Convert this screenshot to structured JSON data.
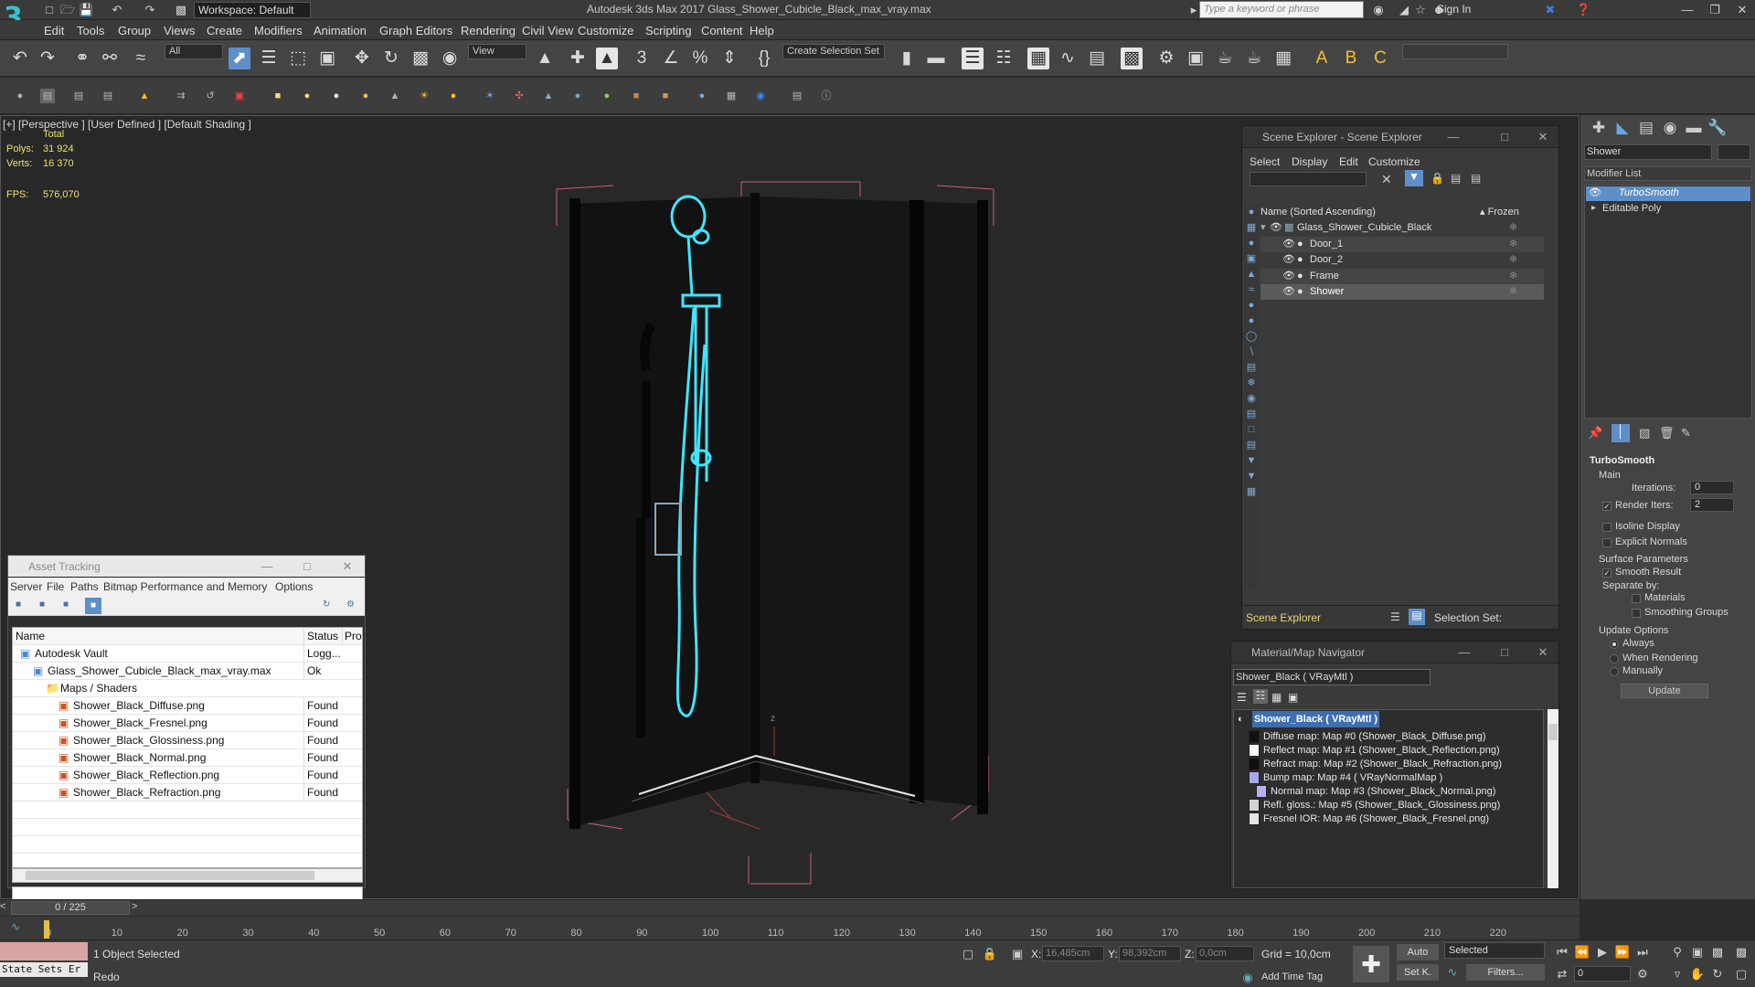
{
  "titlebar": {
    "workspace": "Workspace: Default",
    "window_title": "Autodesk 3ds Max 2017     Glass_Shower_Cubicle_Black_max_vray.max",
    "search_placeholder": "Type a keyword or phrase",
    "sign_in": "Sign In"
  },
  "menu": [
    "Edit",
    "Tools",
    "Group",
    "Views",
    "Create",
    "Modifiers",
    "Animation",
    "Graph Editors",
    "Rendering",
    "Civil View",
    "Customize",
    "Scripting",
    "Content",
    "Help"
  ],
  "toolbar": {
    "filter": "All",
    "ref_coord": "View",
    "selection_set": "Create Selection Set"
  },
  "viewport": {
    "label": "[+] [Perspective ]  [User Defined ]  [Default Shading ]",
    "stats_header": "Total",
    "polys_label": "Polys:",
    "polys_value": "31 924",
    "verts_label": "Verts:",
    "verts_value": "16 370",
    "fps_label": "FPS:",
    "fps_value": "576,070"
  },
  "scene_explorer": {
    "title": "Scene Explorer - Scene Explorer",
    "menu": [
      "Select",
      "Display",
      "Edit",
      "Customize"
    ],
    "col_name": "Name (Sorted Ascending)",
    "col_frozen": "▴ Frozen",
    "root": "Glass_Shower_Cubicle_Black",
    "children": [
      "Door_1",
      "Door_2",
      "Frame",
      "Shower"
    ],
    "footer_label": "Scene Explorer",
    "selection_set": "Selection Set:"
  },
  "asset_tracking": {
    "title": "Asset Tracking",
    "menu": [
      "Server",
      "File",
      "Paths",
      "Bitmap Performance and Memory",
      "Options"
    ],
    "headers": [
      "Name",
      "Status",
      "Prox"
    ],
    "rows": [
      {
        "name": "Autodesk Vault",
        "status": "Logg...",
        "indent": 0
      },
      {
        "name": "Glass_Shower_Cubicle_Black_max_vray.max",
        "status": "Ok",
        "indent": 1
      },
      {
        "name": "Maps / Shaders",
        "status": "",
        "indent": 2
      },
      {
        "name": "Shower_Black_Diffuse.png",
        "status": "Found",
        "indent": 3
      },
      {
        "name": "Shower_Black_Fresnel.png",
        "status": "Found",
        "indent": 3
      },
      {
        "name": "Shower_Black_Glossiness.png",
        "status": "Found",
        "indent": 3
      },
      {
        "name": "Shower_Black_Normal.png",
        "status": "Found",
        "indent": 3
      },
      {
        "name": "Shower_Black_Reflection.png",
        "status": "Found",
        "indent": 3
      },
      {
        "name": "Shower_Black_Refraction.png",
        "status": "Found",
        "indent": 3
      }
    ]
  },
  "material_navigator": {
    "title": "Material/Map Navigator",
    "current": "Shower_Black  ( VRayMtl )",
    "root": "Shower_Black  ( VRayMtl )",
    "maps": [
      {
        "text": "Diffuse map: Map #0 (Shower_Black_Diffuse.png)",
        "swatch": "#111111",
        "indent": 0
      },
      {
        "text": "Reflect map: Map #1 (Shower_Black_Reflection.png)",
        "swatch": "#f4f4f4",
        "indent": 0
      },
      {
        "text": "Refract map: Map #2 (Shower_Black_Refraction.png)",
        "swatch": "#101010",
        "indent": 0
      },
      {
        "text": "Bump map: Map #4  ( VRayNormalMap )",
        "swatch": "#a8a8f0",
        "indent": 0
      },
      {
        "text": "Normal map: Map #3 (Shower_Black_Normal.png)",
        "swatch": "#b7b2f2",
        "indent": 1
      },
      {
        "text": "Refl. gloss.: Map #5 (Shower_Black_Glossiness.png)",
        "swatch": "#d4d4d4",
        "indent": 0
      },
      {
        "text": "Fresnel IOR: Map #6 (Shower_Black_Fresnel.png)",
        "swatch": "#e4e4e4",
        "indent": 0
      }
    ]
  },
  "command_panel": {
    "object_name": "Shower",
    "modifier_list": "Modifier List",
    "stack": [
      "TurboSmooth",
      "Editable Poly"
    ],
    "rollout": "TurboSmooth",
    "main": "Main",
    "iterations_label": "Iterations:",
    "iterations_value": "0",
    "render_iters_label": "Render Iters:",
    "render_iters_value": "2",
    "isoline": "Isoline Display",
    "explicit_normals": "Explicit Normals",
    "surface_params": "Surface Parameters",
    "smooth_result": "Smooth Result",
    "separate_by": "Separate by:",
    "materials": "Materials",
    "smoothing_groups": "Smoothing Groups",
    "update_options": "Update Options",
    "always": "Always",
    "when_rendering": "When Rendering",
    "manually": "Manually",
    "update_button": "Update"
  },
  "timeline": {
    "frame": "0 / 225",
    "ticks": [
      "0",
      "10",
      "20",
      "30",
      "40",
      "50",
      "60",
      "70",
      "80",
      "90",
      "100",
      "110",
      "120",
      "130",
      "140",
      "150",
      "160",
      "170",
      "180",
      "190",
      "200",
      "210",
      "220"
    ]
  },
  "status": {
    "maxscript": "State Sets Er",
    "selected": "1 Object Selected",
    "prompt": "Redo",
    "x_label": "X:",
    "x_value": "16,485cm",
    "y_label": "Y:",
    "y_value": "98,392cm",
    "z_label": "Z:",
    "z_value": "0,0cm",
    "grid": "Grid = 10,0cm",
    "add_time_tag": "Add Time Tag",
    "auto": "Auto",
    "set_key": "Set K.",
    "selected_drop": "Selected",
    "filters": "Filters...",
    "frame_field": "0"
  },
  "colors": {
    "accent_blue": "#5e8fc8",
    "wire_cyan": "#3fe6ff",
    "selection_yellow": "#e8e070",
    "bbox_pink": "#d06a7a"
  }
}
